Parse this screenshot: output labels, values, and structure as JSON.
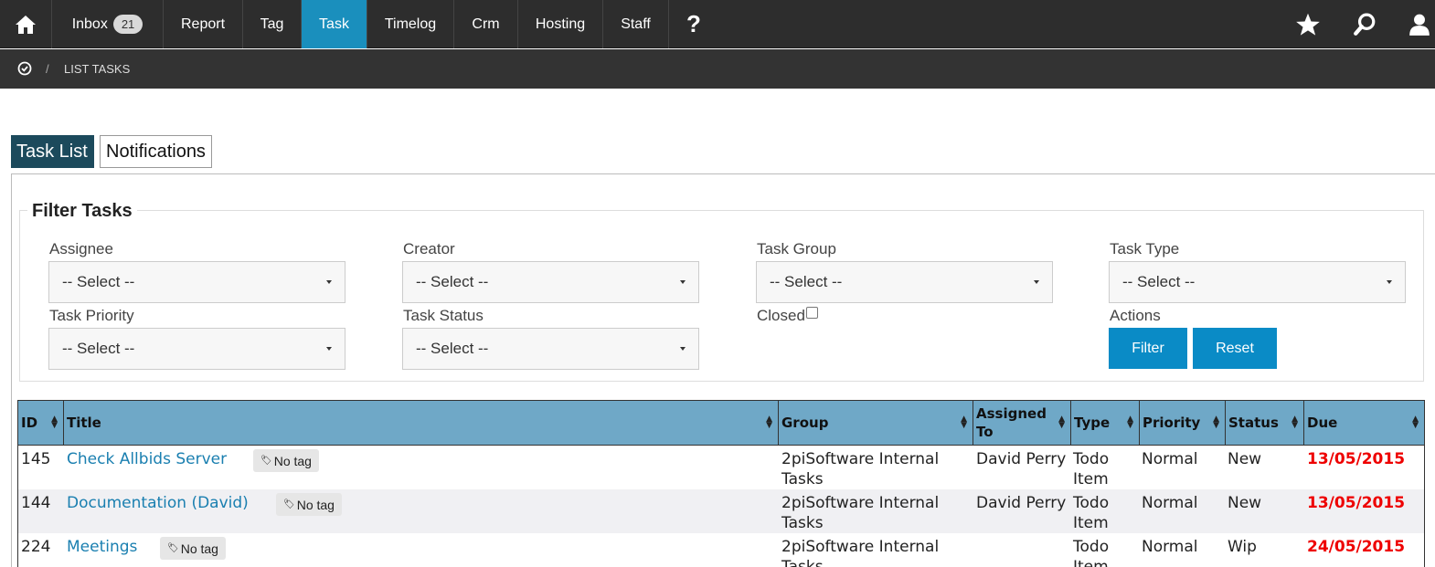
{
  "nav": {
    "items": [
      {
        "label": "Inbox",
        "badge": "21"
      },
      {
        "label": "Report"
      },
      {
        "label": "Tag"
      },
      {
        "label": "Task"
      },
      {
        "label": "Timelog"
      },
      {
        "label": "Crm"
      },
      {
        "label": "Hosting"
      },
      {
        "label": "Staff"
      },
      {
        "label": "?"
      }
    ],
    "active": "Task",
    "icons": [
      "home-icon",
      "star-icon",
      "search-icon",
      "user-icon"
    ]
  },
  "breadcrumb": {
    "separator": "/",
    "current": "LIST TASKS",
    "icon": "check-circle-icon"
  },
  "tabs": [
    {
      "label": "Task List",
      "active": true
    },
    {
      "label": "Notifications",
      "active": false
    }
  ],
  "filter": {
    "title": "Filter Tasks",
    "fields": [
      {
        "label": "Assignee",
        "value": "-- Select --"
      },
      {
        "label": "Creator",
        "value": "-- Select --"
      },
      {
        "label": "Task Group",
        "value": "-- Select --"
      },
      {
        "label": "Task Type",
        "value": "-- Select --"
      },
      {
        "label": "Task Priority",
        "value": "-- Select --"
      },
      {
        "label": "Task Status",
        "value": "-- Select --"
      }
    ],
    "closed_label": "Closed",
    "closed_checked": false,
    "actions_label": "Actions",
    "filter_button": "Filter",
    "reset_button": "Reset"
  },
  "table": {
    "columns": [
      "ID",
      "Title",
      "Group",
      "Assigned To",
      "Type",
      "Priority",
      "Status",
      "Due"
    ],
    "rows": [
      {
        "id": "145",
        "title": "Check Allbids Server",
        "tag": "No tag",
        "group": [
          "2piSoftware Internal",
          "Tasks"
        ],
        "assigned": "David Perry",
        "type": [
          "Todo",
          "Item"
        ],
        "priority": "Normal",
        "status": "New",
        "due": "13/05/2015"
      },
      {
        "id": "144",
        "title": "Documentation (David)",
        "tag": "No tag",
        "group": [
          "2piSoftware Internal",
          "Tasks"
        ],
        "assigned": "David Perry",
        "type": [
          "Todo",
          "Item"
        ],
        "priority": "Normal",
        "status": "New",
        "due": "13/05/2015"
      },
      {
        "id": "224",
        "title": "Meetings",
        "tag": "No tag",
        "group": [
          "2piSoftware Internal",
          "Tasks"
        ],
        "assigned": "",
        "type": [
          "Todo",
          "Item"
        ],
        "priority": "Normal",
        "status": "Wip",
        "due": "24/05/2015"
      }
    ]
  },
  "colors": {
    "nav_bg": "#2d2d2d",
    "active_nav": "#1a8fbd",
    "table_header": "#6fa8c7",
    "due_date": "#e00000",
    "link": "#1a7fb0",
    "button": "#0a8bc6"
  }
}
